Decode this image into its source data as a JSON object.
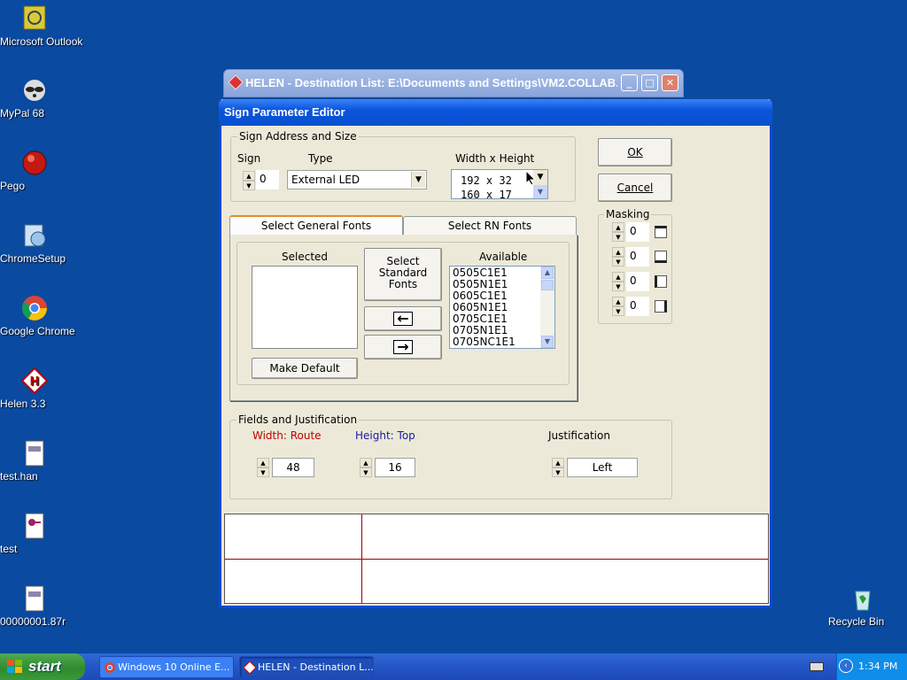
{
  "desktop": {
    "icons": [
      {
        "label": "Microsoft Outlook",
        "icon": "outlook-icon"
      },
      {
        "label": "MyPal 68",
        "icon": "raccoon-icon"
      },
      {
        "label": "Pego",
        "icon": "red-ball-icon"
      },
      {
        "label": "ChromeSetup",
        "icon": "installer-icon"
      },
      {
        "label": "Google Chrome",
        "icon": "chrome-icon"
      },
      {
        "label": "Helen 3.3",
        "icon": "helen-icon"
      },
      {
        "label": "test.han",
        "icon": "document-icon"
      },
      {
        "label": "test",
        "icon": "access-icon"
      },
      {
        "label": "00000001.87r",
        "icon": "document-icon"
      },
      {
        "label": "Recycle Bin",
        "icon": "recycle-bin-icon"
      }
    ]
  },
  "background_window": {
    "title": "HELEN - Destination List: E:\\Documents and Settings\\VM2.COLLAB..."
  },
  "dialog": {
    "title": "Sign Parameter Editor",
    "address_group": {
      "label": "Sign Address and Size",
      "sign_label": "Sign",
      "sign_value": "0",
      "type_label": "Type",
      "type_value": "External LED",
      "size_label": "Width x Height",
      "size_options": [
        "192  x  32",
        "160  x  17"
      ]
    },
    "ok_label": "OK",
    "cancel_label": "Cancel",
    "masking": {
      "label": "Masking",
      "values": [
        "0",
        "0",
        "0",
        "0"
      ]
    },
    "tabs": [
      "Select General Fonts",
      "Select RN Fonts"
    ],
    "fonts": {
      "selected_label": "Selected",
      "available_label": "Available",
      "select_standard_label": "Select Standard Fonts",
      "make_default_label": "Make Default",
      "available_items": [
        "0505C1E1",
        "0505N1E1",
        "0605C1E1",
        "0605N1E1",
        "0705C1E1",
        "0705N1E1",
        "0705NC1E1"
      ]
    },
    "fields_group": {
      "label": "Fields and Justification",
      "width_label": "Width: Route",
      "height_label": "Height: Top",
      "justification_label": "Justification",
      "width_value": "48",
      "height_value": "16",
      "justification_value": "Left"
    }
  },
  "taskbar": {
    "start_label": "start",
    "tasks": [
      "Windows 10 Online E...",
      "HELEN - Destination L..."
    ],
    "clock": "1:34 PM"
  },
  "colors": {
    "desktop": "#0a4aa0",
    "width_label": "#c00000",
    "height_label": "#1a1aa0"
  }
}
